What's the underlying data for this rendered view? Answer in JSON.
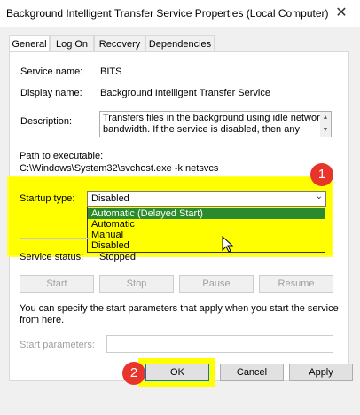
{
  "window": {
    "title": "Background Intelligent Transfer Service Properties (Local Computer)",
    "close_glyph": "✕"
  },
  "tabs": [
    {
      "label": "General",
      "active": true
    },
    {
      "label": "Log On",
      "active": false
    },
    {
      "label": "Recovery",
      "active": false
    },
    {
      "label": "Dependencies",
      "active": false
    }
  ],
  "general": {
    "service_name_label": "Service name:",
    "service_name_value": "BITS",
    "display_name_label": "Display name:",
    "display_name_value": "Background Intelligent Transfer Service",
    "description_label": "Description:",
    "description_line1": "Transfers files in the background using idle network",
    "description_line2": "bandwidth. If the service is disabled, then any",
    "path_label": "Path to executable:",
    "path_value": "C:\\Windows\\System32\\svchost.exe -k netsvcs",
    "startup_type_label": "Startup type:",
    "startup_type_value": "Disabled",
    "startup_options": [
      "Automatic (Delayed Start)",
      "Automatic",
      "Manual",
      "Disabled"
    ],
    "service_status_label": "Service status:",
    "service_status_value": "Stopped",
    "buttons": {
      "start": "Start",
      "stop": "Stop",
      "pause": "Pause",
      "resume": "Resume"
    },
    "help_text_line1": "You can specify the start parameters that apply when you start the service",
    "help_text_line2": "from here.",
    "start_params_label": "Start parameters:",
    "start_params_value": ""
  },
  "dialog_buttons": {
    "ok": "OK",
    "cancel": "Cancel",
    "apply": "Apply"
  },
  "annotations": {
    "badge1": "1",
    "badge2": "2"
  },
  "colors": {
    "highlight": "#ffff00",
    "selected_option": "#2b8a2b",
    "badge": "#e8342b"
  },
  "icons": {
    "close": "close-icon",
    "dropdown": "chevron-down-icon",
    "cursor": "mouse-pointer-icon"
  }
}
